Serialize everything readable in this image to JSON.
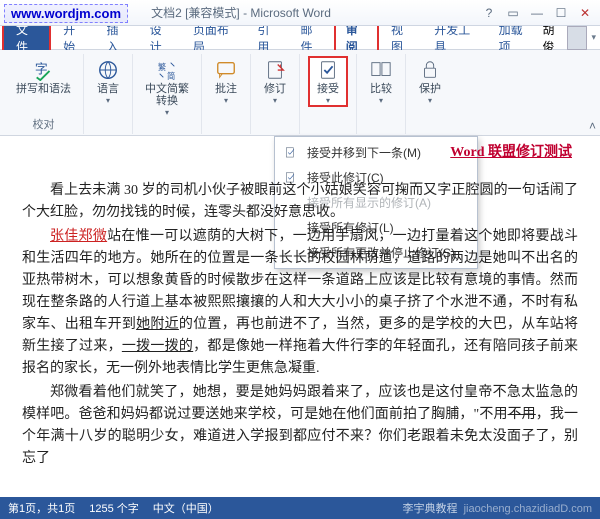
{
  "watermark_url": "www.wordjm.com",
  "title": "文档2 [兼容模式] - Microsoft Word",
  "tabs": {
    "file": "文件",
    "home": "开始",
    "insert": "插入",
    "design": "设计",
    "layout": "页面布局",
    "references": "引用",
    "mailings": "邮件",
    "review": "审阅",
    "view": "视图",
    "developer": "开发工具",
    "addins": "加载项"
  },
  "user_name": "胡俊",
  "ribbon": {
    "spelling_grammar": "拼写和语法",
    "language": "语言",
    "simplified_traditional": "中文简繁\n转换",
    "comment": "批注",
    "revise": "修订",
    "accept": "接受",
    "compare": "比较",
    "protect": "保护",
    "group_proofing": "校对"
  },
  "dropdown": {
    "accept_next": "接受并移到下一条(M)",
    "accept_this": "接受此修订(C)",
    "accept_shown": "接受所有显示的修订(A)",
    "accept_all": "接受所有修订(L)",
    "accept_stop": "接受所有更改并停止修订(S)"
  },
  "doc_header": "Word 联盟修订测试",
  "para1_a": "看上去未满 30 岁的司机小伙子被眼前这个小姑娘笑容可掬而又字正腔圆的一句话闹了个大红脸，勿勿找钱的时候，连零头都没好意思收。",
  "para2_name": "张佳郑微",
  "para2_a": "站在惟一可以遮荫的大树下，一边用手扇风，一边打量着这个她即将要战斗和生活四年的地方。她所在的位置是一条长长的校园林荫道，道路的两边是她叫不出名的亚热带树木，可以想象黄昏的时候散步在这样一条道路上应该是比较有意境的事情。然而现在整条路的人行道上基本被熙熙攘攘的人和大大小小的桌子挤了个水泄不通，不时有私家车、出租车开到",
  "para2_loc": "她附近",
  "para2_b": "的位置，再也前进不了，当然，更多的是学校的大巴，从车站将新生接了过来，",
  "para2_c": "一拨一拨的",
  "para2_d": "，都是像她一样拖着大件行李的年轻面孔，还有陪同孩子前来报名的家长，无一例外地表情比学生更焦急凝重.",
  "para3_a": "郑微看着他们就笑了，她想，要是她妈妈跟着来了，应该也是这付皇帝不急太监急的模样吧。爸爸和妈妈都说过要送她来学校，可是她在他们面前拍了胸脯，\"不用",
  "para3_strike": "不用",
  "para3_b": "，我一个年满十八岁的聪明少女，难道进入学报到都应付不来？你们老跟着未免太没面子了，别忘了",
  "status": {
    "page": "第1页，共1页",
    "words": "1255 个字",
    "lang": "中文（中国）"
  },
  "footer_wm_a": "李宇典教程",
  "footer_wm_b": "jiaocheng.chazidiadD.com"
}
